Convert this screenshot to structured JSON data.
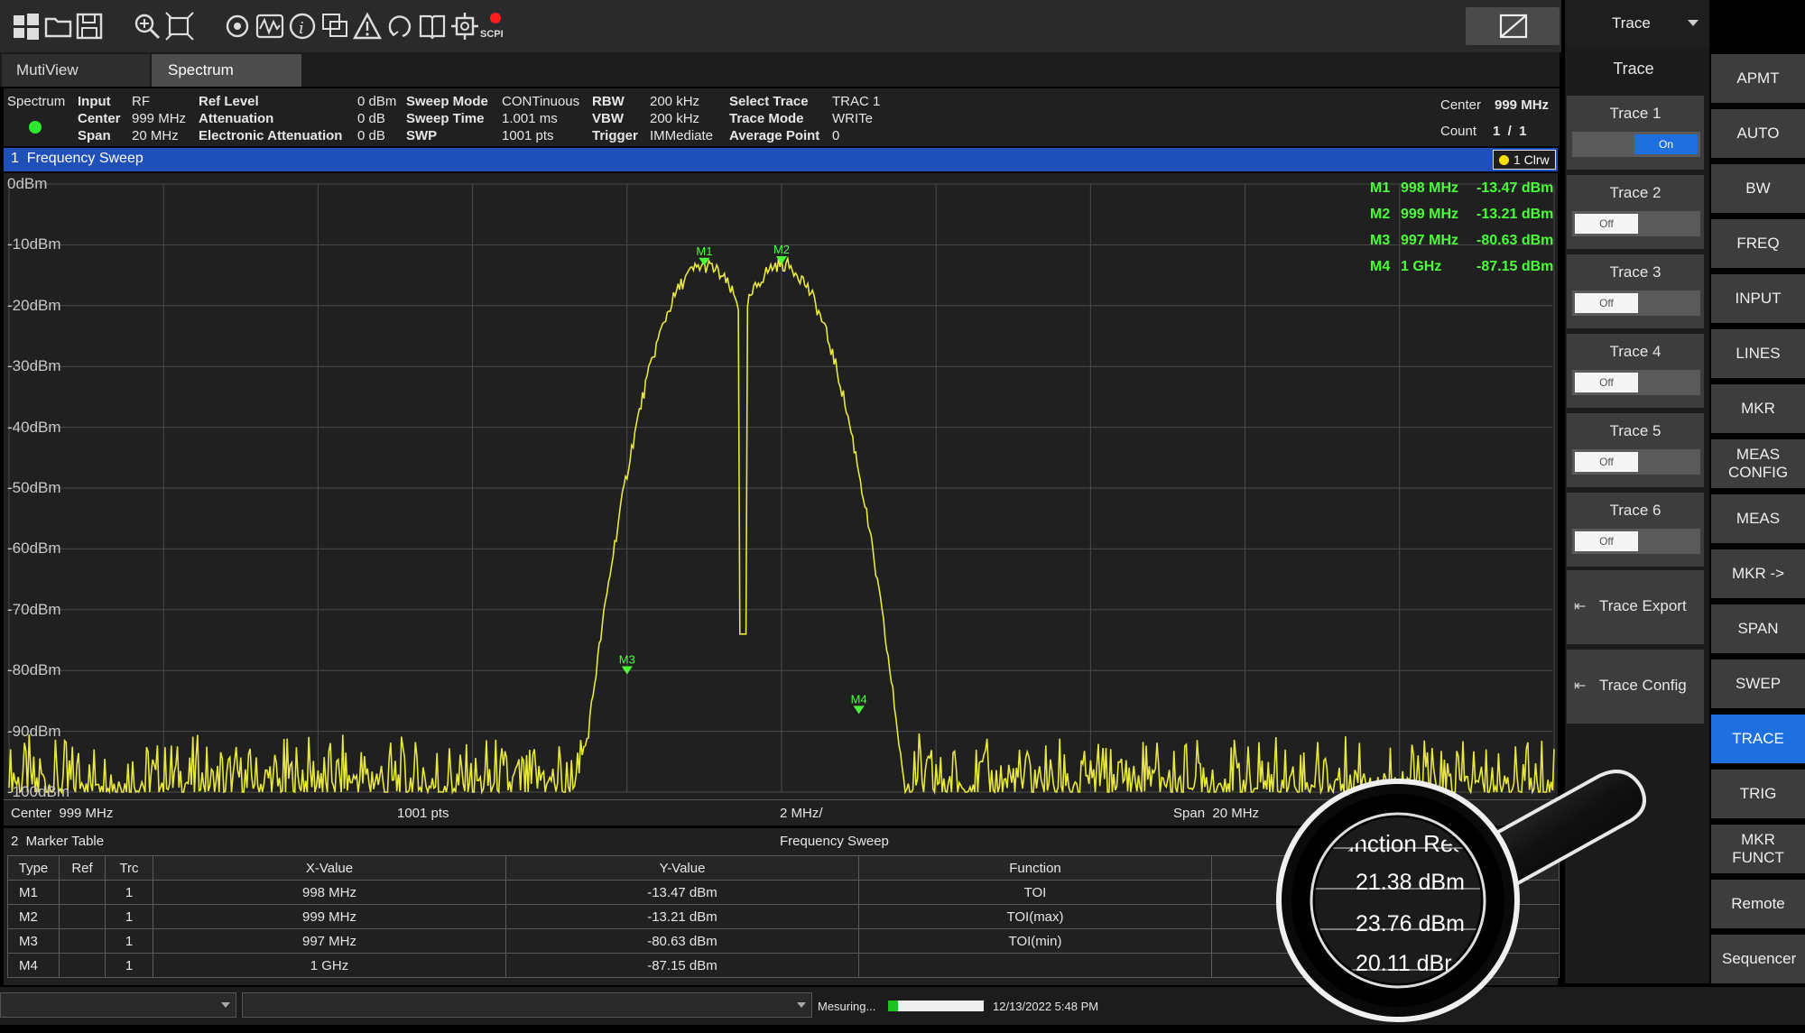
{
  "toolbar": {
    "icons": [
      "windows-icon",
      "folder-open-icon",
      "save-icon",
      "zoom-in-icon",
      "zoom-fit-icon",
      "refresh-icon",
      "waveform-icon",
      "info-icon",
      "multi-window-icon",
      "warning-icon",
      "undo-icon",
      "manual-icon",
      "settings-icon",
      "scpi-icon"
    ],
    "scpi_label": "SCPI"
  },
  "dropdown": {
    "label": "Trace"
  },
  "tabs": [
    "MutiView",
    "Spectrum"
  ],
  "info": {
    "mode": "Spectrum",
    "input_label": "Input",
    "input_value": "RF",
    "center_label": "Center",
    "center_value": "999 MHz",
    "span_label": "Span",
    "span_value": "20 MHz",
    "ref_level_label": "Ref Level",
    "ref_level_value": "0 dBm",
    "attenuation_label": "Attenuation",
    "attenuation_value": "0 dB",
    "elec_att_label": "Electronic Attenuation",
    "elec_att_value": "0 dB",
    "sweep_mode_label": "Sweep Mode",
    "sweep_mode_value": "CONTinuous",
    "sweep_time_label": "Sweep Time",
    "sweep_time_value": "1.001 ms",
    "swp_label": "SWP",
    "swp_value": "1001 pts",
    "rbw_label": "RBW",
    "rbw_value": "200 kHz",
    "vbw_label": "VBW",
    "vbw_value": "200 kHz",
    "trigger_label": "Trigger",
    "trigger_value": "IMMediate",
    "select_trace_label": "Select Trace",
    "select_trace_value": "TRAC 1",
    "trace_mode_label": "Trace Mode",
    "trace_mode_value": "WRITe",
    "avg_point_label": "Average Point",
    "avg_point_value": "0",
    "right_center_label": "Center",
    "right_center_value": "999 MHz",
    "count_label": "Count",
    "count_value": "1  /  1"
  },
  "window": {
    "title": "1  Frequency Sweep",
    "trace_tag": "1 Clrw"
  },
  "plot": {
    "y_labels": [
      "0dBm",
      "-10dBm",
      "-20dBm",
      "-30dBm",
      "-40dBm",
      "-50dBm",
      "-60dBm",
      "-70dBm",
      "-80dBm",
      "-90dBm",
      "-100dBm"
    ],
    "y_values": [
      0,
      -10,
      -20,
      -30,
      -40,
      -50,
      -60,
      -70,
      -80,
      -90,
      -100
    ],
    "ylim": [
      -100,
      0
    ],
    "x_center_mhz": 999,
    "x_span_mhz": 20,
    "markers": [
      {
        "name": "M1",
        "freq_mhz": 998,
        "level": -13.47,
        "freq_text": "998 MHz",
        "level_text": "-13.47 dBm"
      },
      {
        "name": "M2",
        "freq_mhz": 999,
        "level": -13.21,
        "freq_text": "999 MHz",
        "level_text": "-13.21 dBm"
      },
      {
        "name": "M3",
        "freq_mhz": 997,
        "level": -80.63,
        "freq_text": "997 MHz",
        "level_text": "-80.63 dBm"
      },
      {
        "name": "M4",
        "freq_mhz": 1000,
        "level": -87.15,
        "freq_text": "1 GHz",
        "level_text": "-87.15 dBm"
      }
    ],
    "footer_center": "Center  999 MHz",
    "footer_pts": "1001 pts",
    "footer_div": "2 MHz/",
    "footer_span": "Span  20 MHz",
    "trace_color": "#e8e83a",
    "marker_color": "#4aff3a"
  },
  "marker_table": {
    "title": "2  Marker Table",
    "subtitle": "Frequency Sweep",
    "headers": [
      "Type",
      "Ref",
      "Trc",
      "X-Value",
      "Y-Value",
      "Function"
    ],
    "rows": [
      [
        "M1",
        "",
        "1",
        "998 MHz",
        "-13.47 dBm",
        "TOI"
      ],
      [
        "M2",
        "",
        "1",
        "999 MHz",
        "-13.21 dBm",
        "TOI(max)"
      ],
      [
        "M3",
        "",
        "1",
        "997 MHz",
        "-80.63 dBm",
        "TOI(min)"
      ],
      [
        "M4",
        "",
        "1",
        "1 GHz",
        "-87.15 dBm",
        ""
      ]
    ]
  },
  "trace_panel": {
    "title": "Trace",
    "traces": [
      {
        "label": "Trace 1",
        "state": "On"
      },
      {
        "label": "Trace 2",
        "state": "Off"
      },
      {
        "label": "Trace 3",
        "state": "Off"
      },
      {
        "label": "Trace 4",
        "state": "Off"
      },
      {
        "label": "Trace 5",
        "state": "Off"
      },
      {
        "label": "Trace 6",
        "state": "Off"
      }
    ],
    "export_label": "Trace Export",
    "config_label": "Trace Config"
  },
  "softkeys": [
    "APMT",
    "AUTO",
    "BW",
    "FREQ",
    "INPUT",
    "LINES",
    "MKR",
    "MEAS CONFIG",
    "MEAS",
    "MKR ->",
    "SPAN",
    "SWEP",
    "TRACE",
    "TRIG",
    "MKR FUNCT",
    "Remote",
    "Sequencer"
  ],
  "softkey_active": "TRACE",
  "status": {
    "measuring": "Mesuring...",
    "datetime": "12/13/2022 5:48 PM",
    "progress": 0.1
  },
  "magnifier": {
    "header": "unction Res",
    "values": [
      "21.38 dBm",
      "23.76 dBm",
      "20.11 dBr"
    ]
  },
  "colors": {
    "accent": "#1e6fe0",
    "window_bar": "#1f4fb8",
    "status_green": "#2ee82e"
  }
}
